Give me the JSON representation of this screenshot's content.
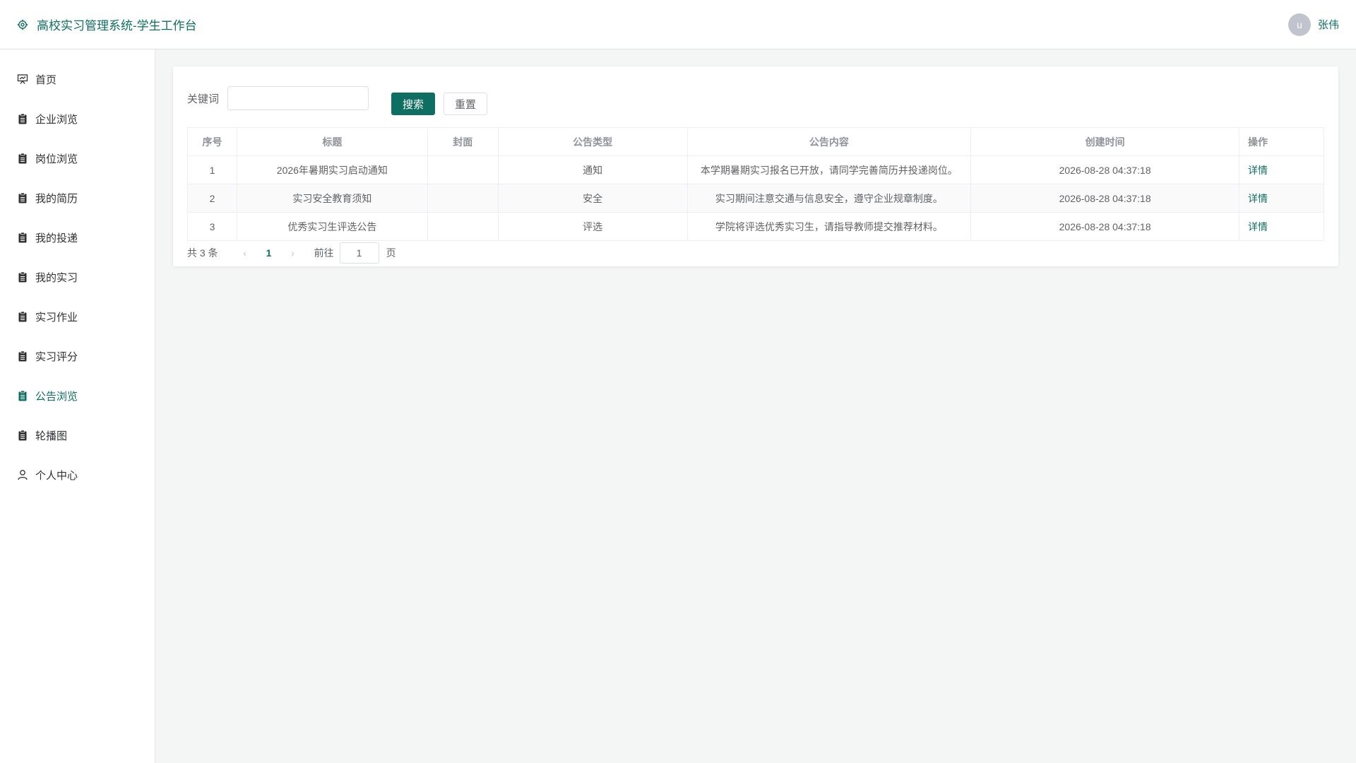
{
  "header": {
    "title": "高校实习管理系统-学生工作台",
    "avatar_letter": "u",
    "user_name": "张伟"
  },
  "sidebar": {
    "items": [
      {
        "label": "首页",
        "icon": "presentation-icon",
        "active": false
      },
      {
        "label": "企业浏览",
        "icon": "clipboard-icon",
        "active": false
      },
      {
        "label": "岗位浏览",
        "icon": "clipboard-icon",
        "active": false
      },
      {
        "label": "我的简历",
        "icon": "clipboard-icon",
        "active": false
      },
      {
        "label": "我的投递",
        "icon": "clipboard-icon",
        "active": false
      },
      {
        "label": "我的实习",
        "icon": "clipboard-icon",
        "active": false
      },
      {
        "label": "实习作业",
        "icon": "clipboard-icon",
        "active": false
      },
      {
        "label": "实习评分",
        "icon": "clipboard-icon",
        "active": false
      },
      {
        "label": "公告浏览",
        "icon": "clipboard-icon",
        "active": true
      },
      {
        "label": "轮播图",
        "icon": "clipboard-icon",
        "active": false
      },
      {
        "label": "个人中心",
        "icon": "user-icon",
        "active": false
      }
    ]
  },
  "search": {
    "label": "关键词",
    "value": "",
    "placeholder": "",
    "search_button": "搜索",
    "reset_button": "重置"
  },
  "table": {
    "headers": [
      "序号",
      "标题",
      "封面",
      "公告类型",
      "公告内容",
      "创建时间",
      "操作"
    ],
    "rows": [
      {
        "index": "1",
        "title": "2026年暑期实习启动通知",
        "cover": "",
        "type": "通知",
        "content": "本学期暑期实习报名已开放，请同学完善简历并投递岗位。",
        "created": "2026-08-28 04:37:18",
        "action": "详情"
      },
      {
        "index": "2",
        "title": "实习安全教育须知",
        "cover": "",
        "type": "安全",
        "content": "实习期间注意交通与信息安全，遵守企业规章制度。",
        "created": "2026-08-28 04:37:18",
        "action": "详情"
      },
      {
        "index": "3",
        "title": "优秀实习生评选公告",
        "cover": "",
        "type": "评选",
        "content": "学院将评选优秀实习生，请指导教师提交推荐材料。",
        "created": "2026-08-28 04:37:18",
        "action": "详情"
      }
    ]
  },
  "pagination": {
    "total_text": "共 3 条",
    "current_page": "1",
    "goto_label": "前往",
    "goto_value": "1",
    "page_unit": "页"
  },
  "colors": {
    "primary": "#0f6e62",
    "background": "#f4f5f5"
  }
}
